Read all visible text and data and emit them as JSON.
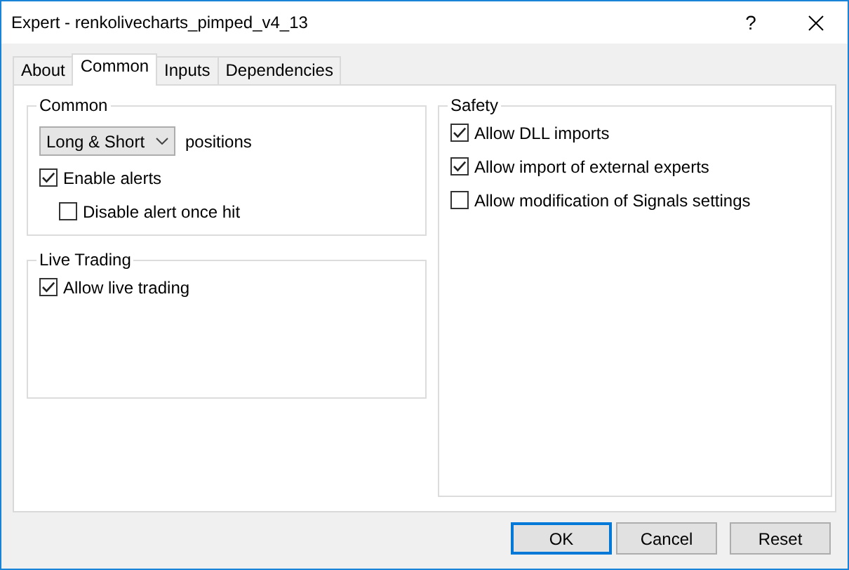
{
  "window": {
    "title": "Expert - renkolivecharts_pimped_v4_13",
    "help_label": "?"
  },
  "tabs": [
    {
      "label": "About",
      "selected": false
    },
    {
      "label": "Common",
      "selected": true
    },
    {
      "label": "Inputs",
      "selected": false
    },
    {
      "label": "Dependencies",
      "selected": false
    }
  ],
  "common": {
    "title": "Common",
    "position_mode": {
      "value": "Long & Short"
    },
    "positions_label": "positions",
    "options": [
      {
        "label": "Enable alerts",
        "checked": true,
        "children": [
          {
            "label": "Disable alert once hit",
            "checked": false
          }
        ]
      }
    ]
  },
  "live_trading": {
    "title": "Live Trading",
    "options": [
      {
        "label": "Allow live trading",
        "checked": true
      }
    ]
  },
  "safety": {
    "title": "Safety",
    "options": [
      {
        "label": "Allow DLL imports",
        "checked": true
      },
      {
        "label": "Allow import of external experts",
        "checked": true
      },
      {
        "label": "Allow modification of Signals settings",
        "checked": false
      }
    ]
  },
  "buttons": [
    {
      "label": "OK",
      "default": true
    },
    {
      "label": "Cancel",
      "default": false
    },
    {
      "label": "Reset",
      "default": false
    }
  ]
}
